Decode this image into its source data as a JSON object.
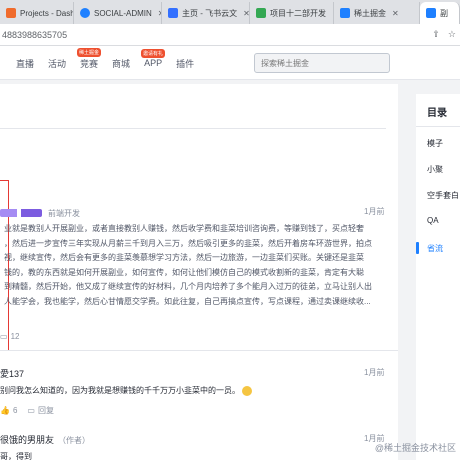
{
  "browser": {
    "tabs": [
      {
        "label": "Projects - Dash",
        "icon_color": "#f06b2c"
      },
      {
        "label": "SOCIAL-ADMIN",
        "icon_color": "#1e80ff"
      },
      {
        "label": "主页 - 飞书云文",
        "icon_color": "#3370ff"
      },
      {
        "label": "项目十二部开发",
        "icon_color": "#34a853"
      },
      {
        "label": "稀土掘金",
        "icon_color": "#1e80ff"
      },
      {
        "label": "副",
        "icon_color": "#1e80ff"
      }
    ],
    "url": "4883988635705"
  },
  "nav": {
    "items": [
      {
        "label": "直播",
        "badge": ""
      },
      {
        "label": "活动",
        "badge": ""
      },
      {
        "label": "竞赛",
        "badge": "稀土掘金"
      },
      {
        "label": "商城",
        "badge": ""
      },
      {
        "label": "APP",
        "badge": "邀请有礼"
      },
      {
        "label": "插件",
        "badge": ""
      }
    ],
    "search_placeholder": "探索稀土掘金"
  },
  "article": {
    "tag": "前端开发",
    "time": "1月前",
    "body_lines": [
      "业就是教别人开展副业，或者直接教别人赚钱，然后收学费和韭菜培训咨询费，等赚到钱了，买点轻奢",
      "，然后进一步宣传三年实现从月薪三千到月入三万，然后吸引更多的韭菜，然后开着房车环游世界，拍点",
      "视，继续宣传，然后会有更多的韭菜羡慕想学习方法，然后一边旅游，一边韭菜们买账。关键还是韭菜",
      "钱的，教的东西就是如何开展副业，如何宣传，如何让他们模仿自己的模式收割新的韭菜，肯定有大聪",
      "到精髓，然后开始，他又成了继续宣传的好材料，几个月内培养了多个能月入过万的徒弟，立马让别人出",
      "人能学会，我也能学，然后心甘情愿交学费。如此往复，自己再搞点宣传，写点课程，通过卖课继续收..."
    ],
    "comment_count": "12"
  },
  "comments": [
    {
      "name": "愛137",
      "time": "1月前",
      "text": "别问我怎么知道的，因为我就是想赚钱的千千万万小韭菜中的一员。",
      "likes": "6",
      "reply": "回复"
    },
    {
      "name": "很饿的男朋友",
      "role": "（作者）",
      "time": "1月前",
      "text": "哥，得到"
    }
  ],
  "toc": {
    "title": "目录",
    "items": [
      {
        "label": "模子",
        "active": false
      },
      {
        "label": "小聚",
        "active": false
      },
      {
        "label": "空手套白",
        "active": false
      },
      {
        "label": "QA",
        "active": false
      },
      {
        "label": "省流",
        "active": true
      }
    ]
  },
  "watermark": "@稀土掘金技术社区"
}
